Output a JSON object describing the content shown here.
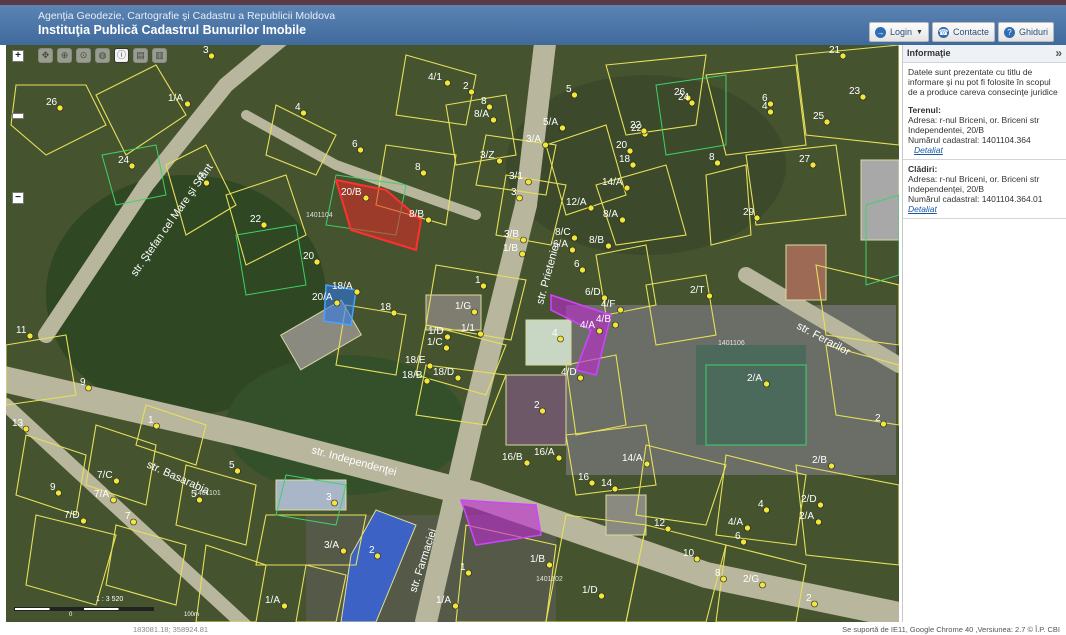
{
  "header": {
    "org": "Agenţia Geodezie, Cartografie şi Cadastru a Republicii Moldova",
    "institution": "Instituţia Publică Cadastrul Bunurilor Imobile"
  },
  "topbar": {
    "login": "Login",
    "contacts": "Contacte",
    "guides": "Ghiduri"
  },
  "panel": {
    "title": "Informaţie",
    "collapse": "»",
    "note": "Datele sunt prezentate cu titlu de informare şi nu pot fi folosite în scopul de a produce careva consecinţe juridice",
    "terrain": {
      "heading": "Terenul:",
      "address": "Adresa: r-nul Briceni, or. Briceni str Independentei, 20/B",
      "cadastral": "Numărul cadastral: 1401104.364",
      "link": "Detaliat"
    },
    "buildings": {
      "heading": "Clădiri:",
      "address": "Adresa: r-nul Briceni, or. Briceni str Independenţei, 20/B",
      "cadastral": "Numărul cadastral: 1401104.364.01",
      "link": "Detaliat"
    }
  },
  "map": {
    "zoom_in": "+",
    "zoom_out": "−",
    "streets": [
      "str. Ştefan cel Mare şi Sfânt",
      "str. Independenţei",
      "str. Basarabia",
      "str. Prieteniei",
      "str. Ferarilor",
      "str. Farmaciei"
    ],
    "parcel_labels": [
      "20/B",
      "8/B",
      "3",
      "26",
      "1/A",
      "24",
      "2",
      "22",
      "20",
      "20/A",
      "18/A",
      "18",
      "4",
      "6",
      "8",
      "4/1",
      "2",
      "8",
      "8/A",
      "3/A",
      "5/A",
      "5",
      "3/Z",
      "3/1",
      "3",
      "3/B",
      "1/B",
      "1",
      "1/G",
      "1/D",
      "1/C",
      "1/1",
      "18/E",
      "18/B",
      "18/D",
      "12/A",
      "8/A",
      "8/C",
      "6/A",
      "8/B",
      "6",
      "22",
      "20",
      "18",
      "14/A",
      "6/D",
      "4/F",
      "4/A",
      "4/B",
      "4/D",
      "4",
      "2",
      "16/B",
      "16/A",
      "14/A",
      "14",
      "16",
      "12",
      "26",
      "24",
      "22",
      "8",
      "29",
      "2/T",
      "2/A",
      "27",
      "25",
      "23",
      "21",
      "6",
      "4",
      "11",
      "9",
      "13",
      "7",
      "5",
      "1",
      "7/C",
      "7/A",
      "7/D",
      "9",
      "5",
      "3",
      "3/A",
      "2",
      "1",
      "1/B",
      "1/D",
      "1/A",
      "1/A",
      "4/A",
      "6",
      "10",
      "8",
      "2/G",
      "2/A",
      "2/D",
      "2/B",
      "2",
      "4",
      "2"
    ],
    "sector_labels": [
      "1401104",
      "1401106",
      "1401101",
      "1401102"
    ],
    "scale": "1 : 3 520",
    "scale_start": "0",
    "scale_end": "100m"
  },
  "footer": {
    "coords": "183081.18; 358924.81",
    "support": "Se suportă de IE11, Google Chrome 40 ,Versiunea: 2.7 © Î.P. CBI"
  }
}
